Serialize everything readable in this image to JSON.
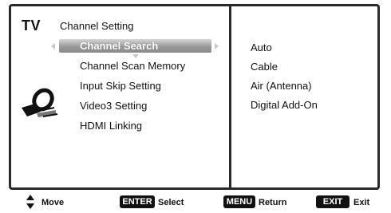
{
  "screen": {
    "source_label": "TV",
    "menu_title": "Channel Setting"
  },
  "menu": {
    "items": [
      {
        "label": "Channel Search",
        "selected": true
      },
      {
        "label": "Channel Scan Memory",
        "selected": false
      },
      {
        "label": "Input Skip Setting",
        "selected": false
      },
      {
        "label": "Video3 Setting",
        "selected": false
      },
      {
        "label": "HDMI Linking",
        "selected": false
      }
    ]
  },
  "options": {
    "items": [
      "Auto",
      "Cable",
      "Air (Antenna)",
      "Digital Add-On"
    ]
  },
  "footer": {
    "move_label": "Move",
    "enter_key": "ENTER",
    "enter_label": "Select",
    "menu_key": "MENU",
    "menu_label": "Return",
    "exit_key": "EXIT",
    "exit_label": "Exit"
  },
  "icons": {
    "menu_icon": "satellite-dish-icon",
    "move_icon": "up-down-arrows-icon"
  },
  "colors": {
    "frame": "#2a2a2a",
    "highlight": "#9a9a9a",
    "key_background": "#111111"
  }
}
